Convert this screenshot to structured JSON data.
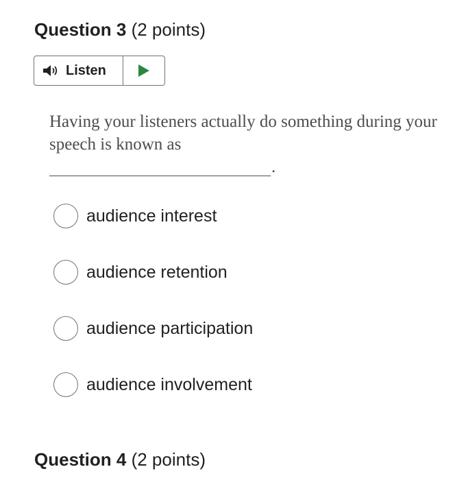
{
  "question3": {
    "title": "Question 3",
    "points": "(2 points)",
    "listen": {
      "label": "Listen",
      "speaker_icon": "speaker-icon",
      "play_icon": "play-icon",
      "play_color": "#2e8540"
    },
    "text": "Having your listeners actually do something during your speech is known as",
    "blank_suffix": ".",
    "options": [
      {
        "label": "audience interest"
      },
      {
        "label": "audience retention"
      },
      {
        "label": "audience participation"
      },
      {
        "label": "audience involvement"
      }
    ]
  },
  "question4": {
    "title": "Question 4",
    "points": "(2 points)"
  }
}
